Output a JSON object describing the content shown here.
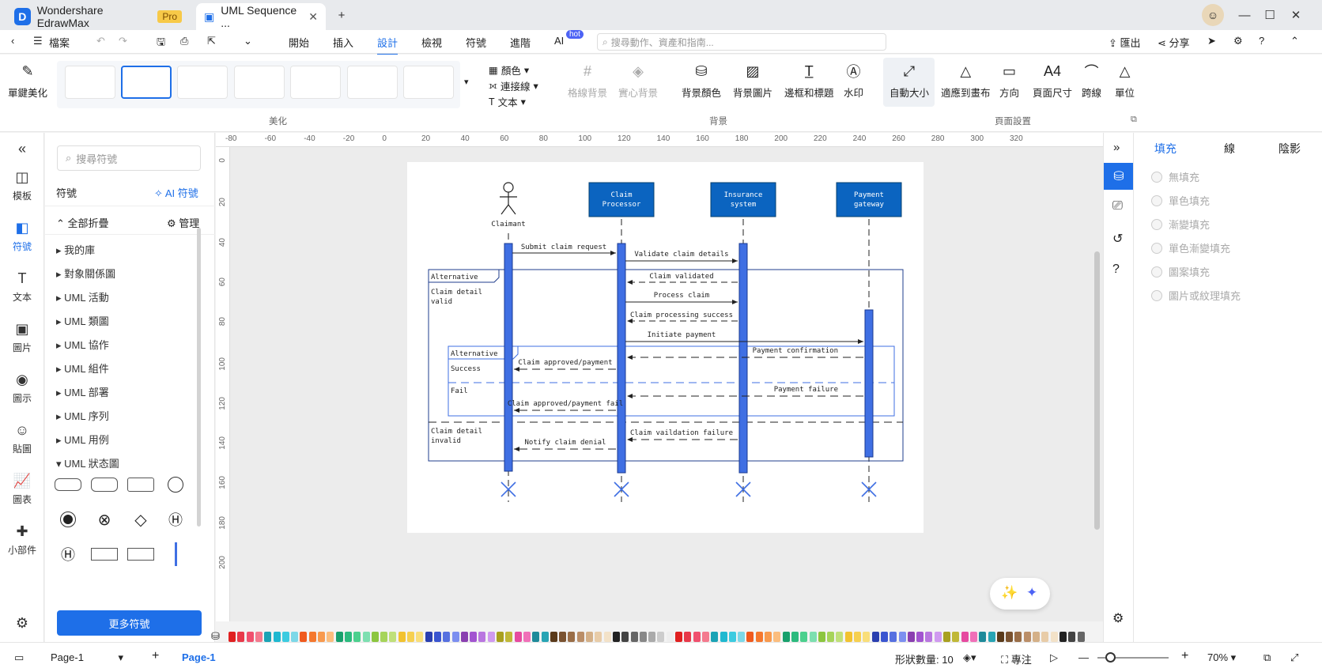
{
  "titlebar": {
    "app_name": "Wondershare EdrawMax",
    "pro_badge": "Pro",
    "doc_tab": "UML Sequence ...",
    "new_tab_icon": "plus-icon"
  },
  "menubar": {
    "file_label": "檔案",
    "items": [
      "開始",
      "插入",
      "設計",
      "檢視",
      "符號",
      "進階",
      "AI"
    ],
    "active": "設計",
    "hot_badge": "hot",
    "search_placeholder": "搜尋動作、資產和指南...",
    "export_label": "匯出",
    "share_label": "分享"
  },
  "ribbon": {
    "one_click_beautify": "單鍵美化",
    "beautify_section": "美化",
    "color_label": "顏色",
    "connector_label": "連接線",
    "text_label": "文本",
    "grid_bg": "格線背景",
    "solid_bg": "實心背景",
    "bg_color": "背景顏色",
    "bg_image": "背景圖片",
    "border_title": "邊框和標題",
    "watermark": "水印",
    "background_section": "背景",
    "auto_size": "自動大小",
    "fit_canvas": "適應到畫布",
    "orientation": "方向",
    "page_size": "頁面尺寸",
    "jump_line": "跨線",
    "unit": "單位",
    "page_setup_section": "頁面設置"
  },
  "leftrail": {
    "items": [
      "模板",
      "符號",
      "文本",
      "圖片",
      "圖示",
      "貼圖",
      "圖表",
      "小部件"
    ],
    "active": "符號"
  },
  "symbolpanel": {
    "search_placeholder": "搜尋符號",
    "title": "符號",
    "ai_symbols": "AI 符號",
    "collapse_all": "全部折疊",
    "manage": "管理",
    "libraries": [
      "我的庫",
      "對象關係圖",
      "UML 活動",
      "UML 類圖",
      "UML 協作",
      "UML 組件",
      "UML 部署",
      "UML 序列",
      "UML 用例",
      "UML 狀态圖"
    ],
    "more_symbols": "更多符號"
  },
  "ruler": {
    "h_ticks": [
      "-80",
      "-60",
      "-40",
      "-20",
      "0",
      "20",
      "40",
      "60",
      "80",
      "100",
      "120",
      "140",
      "160",
      "180",
      "200",
      "220",
      "240",
      "260",
      "280",
      "300",
      "320"
    ],
    "v_ticks": [
      "0",
      "20",
      "40",
      "60",
      "80",
      "100",
      "120",
      "140",
      "160",
      "180",
      "200"
    ]
  },
  "diagram": {
    "actor": "Claimant",
    "lifelines": [
      {
        "line1": "Claim",
        "line2": "Processor"
      },
      {
        "line1": "Insurance",
        "line2": "system"
      },
      {
        "line1": "Payment",
        "line2": "gateway"
      }
    ],
    "messages": [
      "Submit claim request",
      "Validate claim details",
      "Claim validated",
      "Process claim",
      "Claim processing success",
      "Initiate payment",
      "Payment confirmation",
      "Claim approved/payment",
      "Payment failure",
      "Claim approved/payment fail",
      "Claim vaildation failure",
      "Notify claim denial"
    ],
    "frame_outer": "Alternative",
    "guard_valid_1": "Claim detail",
    "guard_valid_2": "valid",
    "frame_inner": "Alternative",
    "guard_success": "Success",
    "guard_fail": "Fail",
    "guard_invalid_1": "Claim detail",
    "guard_invalid_2": "invalid",
    "lifeline_color": "#3f6fe3",
    "header_color": "#0b64c0"
  },
  "rightpanel": {
    "tabs": [
      "填充",
      "線",
      "陰影"
    ],
    "active": "填充",
    "fill_options": [
      "無填充",
      "單色填充",
      "漸變填充",
      "單色漸變填充",
      "圖案填充",
      "圖片或紋理填充"
    ]
  },
  "statusbar": {
    "page_select": "Page-1",
    "page_tab": "Page-1",
    "shape_count_label": "形狀數量: 10",
    "focus_label": "專注",
    "zoom": "70%"
  }
}
